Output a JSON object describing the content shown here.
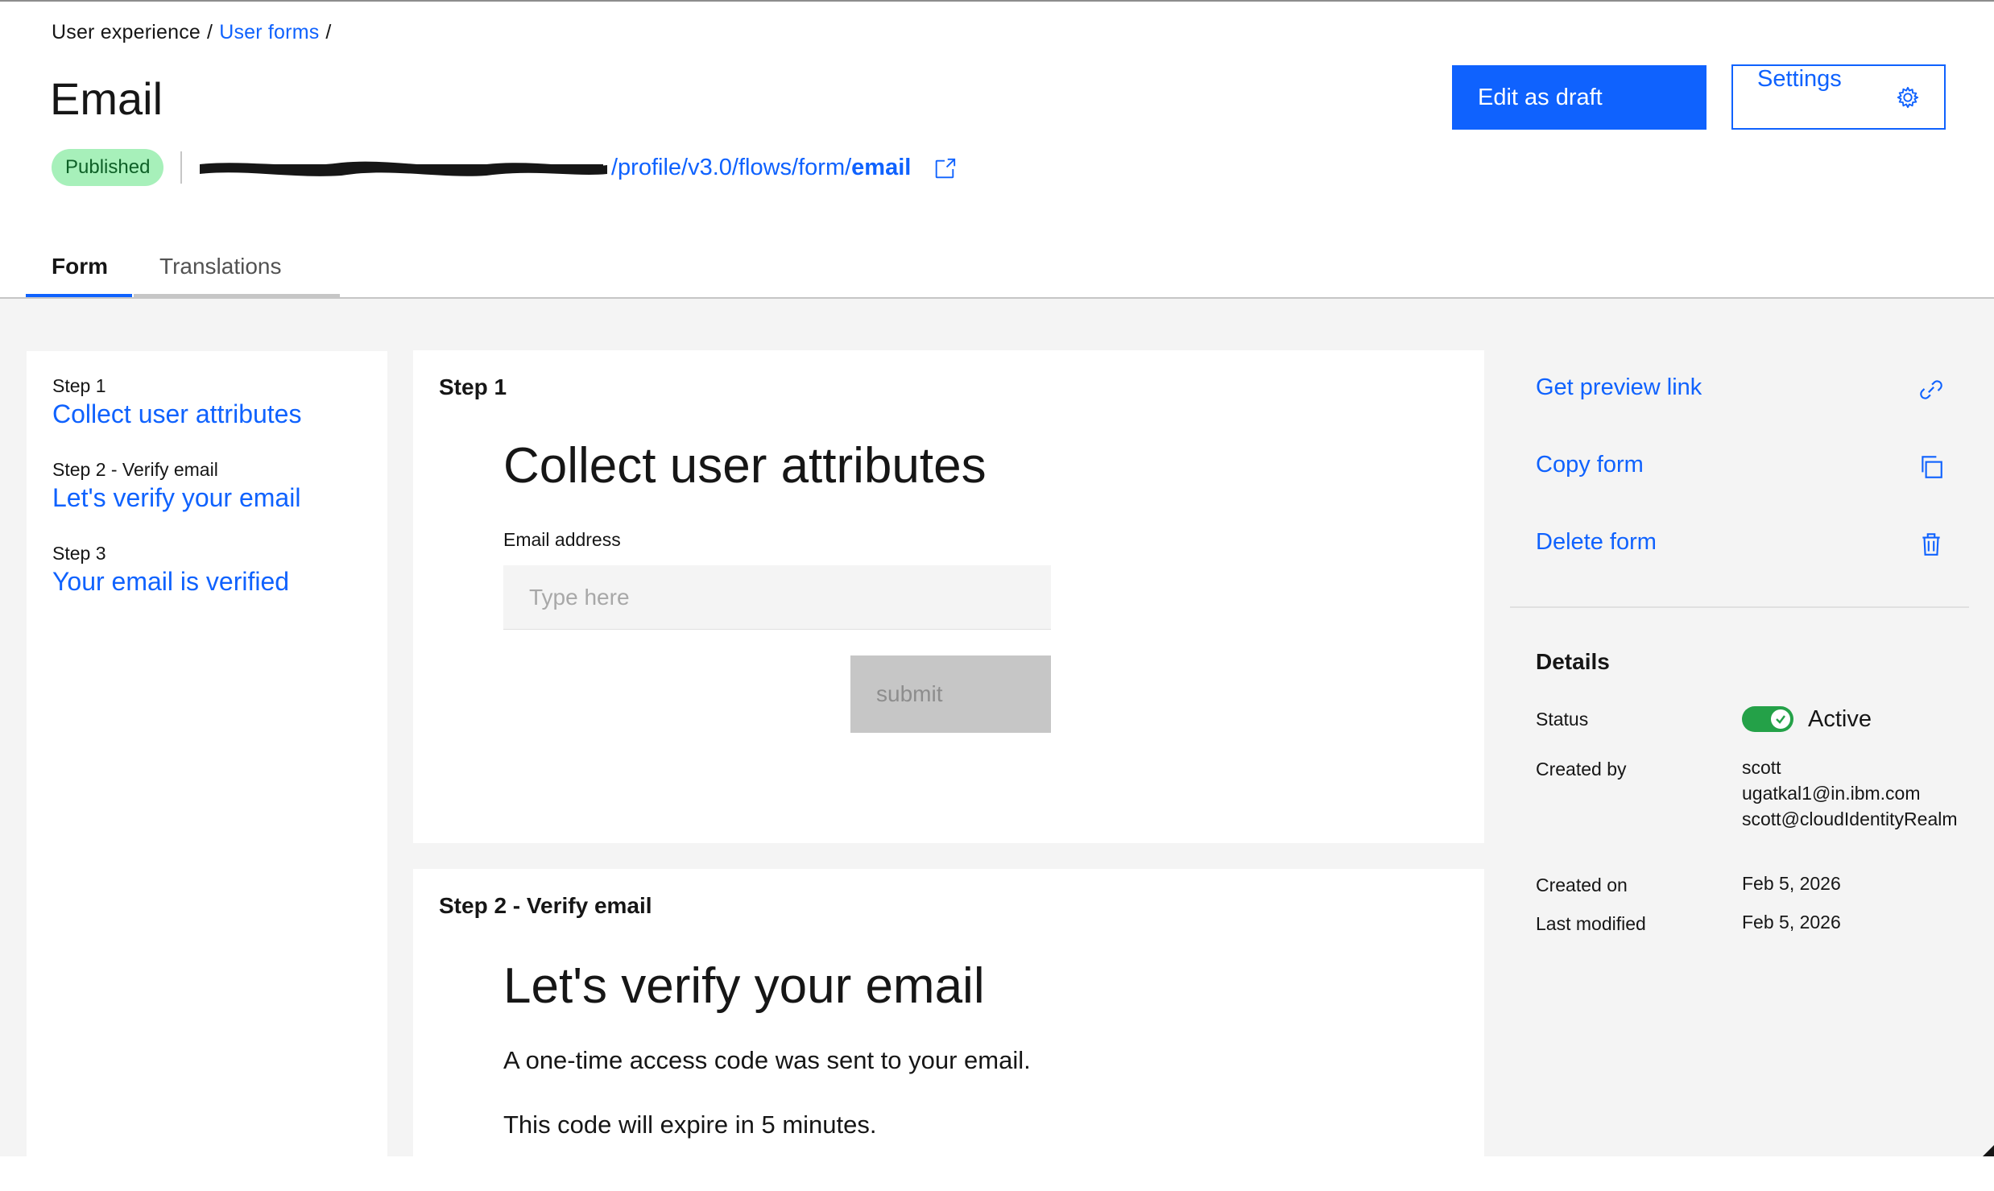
{
  "breadcrumb": {
    "item1": "User experience",
    "separator": "/",
    "item2": "User forms"
  },
  "page": {
    "title": "Email",
    "status_badge": "Published"
  },
  "endpoint": {
    "path": "/profile/v3.0/flows/form/",
    "name": "email"
  },
  "header_actions": {
    "edit_draft": "Edit as draft",
    "settings": "Settings"
  },
  "tabs": [
    {
      "label": "Form",
      "active": true
    },
    {
      "label": "Translations",
      "active": false
    }
  ],
  "steps_nav": [
    {
      "step": "Step 1",
      "title": "Collect user attributes"
    },
    {
      "step": "Step 2 - Verify email",
      "title": "Let's verify your email"
    },
    {
      "step": "Step 3",
      "title": "Your email is verified"
    }
  ],
  "step1_card": {
    "step": "Step 1",
    "heading": "Collect user attributes",
    "field_label": "Email address",
    "placeholder": "Type here",
    "submit": "submit"
  },
  "step2_card": {
    "step": "Step 2 - Verify email",
    "heading": "Let's verify your email",
    "line1": "A one-time access code was sent to your email.",
    "line2": "This code will expire in 5 minutes."
  },
  "actions": [
    {
      "label": "Get preview link",
      "icon": "link-icon"
    },
    {
      "label": "Copy form",
      "icon": "copy-icon"
    },
    {
      "label": "Delete form",
      "icon": "trash-icon"
    }
  ],
  "details": {
    "title": "Details",
    "status_label": "Status",
    "status_value": "Active",
    "created_by_label": "Created by",
    "created_by": [
      "scott",
      "ugatkal1@in.ibm.com",
      "scott@cloudIdentityRealm"
    ],
    "created_on_label": "Created on",
    "created_on": "Feb 5, 2026",
    "modified_label": "Last modified",
    "modified": "Feb 5, 2026"
  },
  "colors": {
    "accent": "#0f62fe",
    "badge_bg": "#a7f0ba",
    "badge_text": "#0e6027",
    "toggle_on": "#24a148",
    "background": "#f4f4f4"
  }
}
